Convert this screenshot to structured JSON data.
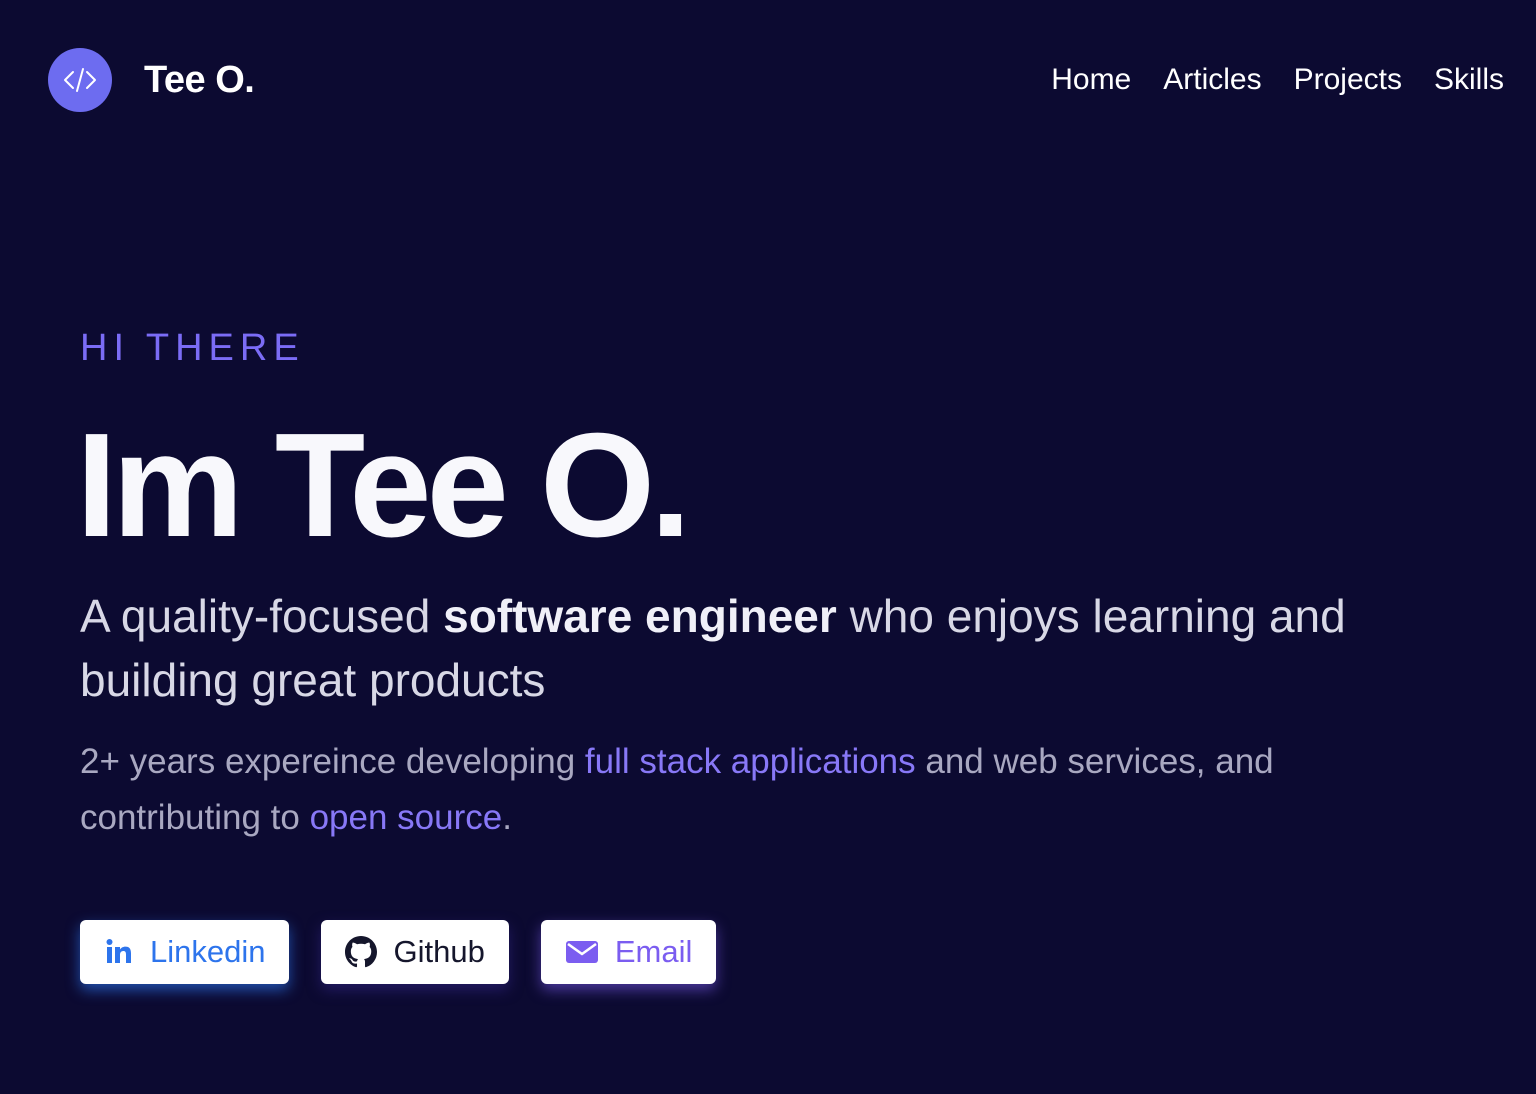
{
  "header": {
    "brand_name": "Tee O.",
    "logo_icon": "code-icon",
    "nav": {
      "home": "Home",
      "articles": "Articles",
      "projects": "Projects",
      "skills": "Skills"
    }
  },
  "hero": {
    "eyebrow": "HI THERE",
    "headline": "Im Tee O.",
    "tagline": {
      "before": "A quality-focused ",
      "bold": "software engineer",
      "after": " who enjoys learning and building great products"
    },
    "description": {
      "part1": "2+ years expereince developing ",
      "link1": "full stack applications",
      "part2": " and web services, and contributing to ",
      "link2": "open source",
      "part3": "."
    }
  },
  "buttons": {
    "linkedin": "Linkedin",
    "github": "Github",
    "email": "Email"
  },
  "colors": {
    "background": "#0c0a31",
    "accent": "#7b6cf6",
    "logo": "#6d6cf0",
    "linkedin": "#2d74ec",
    "email": "#7b5df0"
  }
}
